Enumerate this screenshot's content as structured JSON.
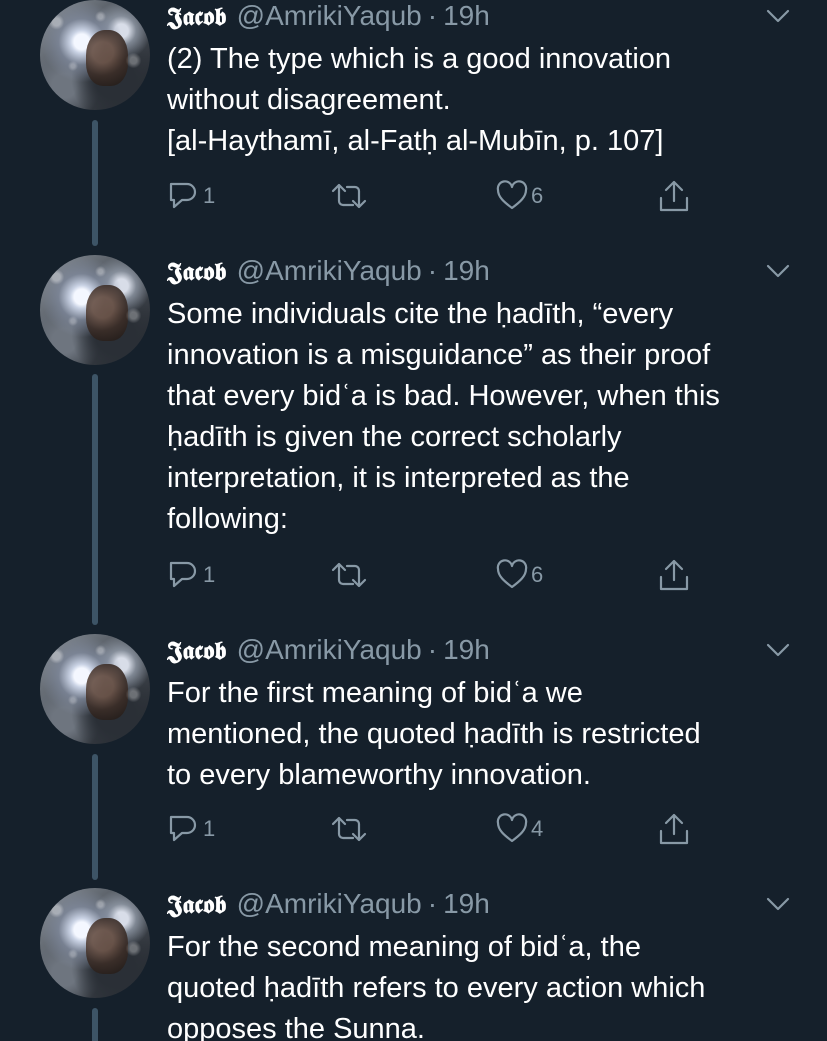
{
  "colors": {
    "background": "#15202b",
    "secondary_text": "#8899a6",
    "thread_line": "#3d5466",
    "primary_text": "#ffffff"
  },
  "tweets": [
    {
      "display_name": "𝕵𝖆𝖈𝖔𝖇",
      "handle": "@AmrikiYaqub",
      "separator": "·",
      "time": "19h",
      "text": "(2) The type which is a good innovation\nwithout disagreement.\n[al-Haythamī, al-Fatḥ al-Mubīn, p. 107]",
      "reply_count": "1",
      "retweet_count": "",
      "like_count": "6"
    },
    {
      "display_name": "𝕵𝖆𝖈𝖔𝖇",
      "handle": "@AmrikiYaqub",
      "separator": "·",
      "time": "19h",
      "text": "Some individuals cite the ḥadīth, “every\ninnovation is a misguidance” as their proof\nthat every bidʿa is bad. However, when this\nḥadīth is given the correct scholarly\ninterpretation, it is interpreted as the\nfollowing:",
      "reply_count": "1",
      "retweet_count": "",
      "like_count": "6"
    },
    {
      "display_name": "𝕵𝖆𝖈𝖔𝖇",
      "handle": "@AmrikiYaqub",
      "separator": "·",
      "time": "19h",
      "text": "For the first meaning of bidʿa we\nmentioned, the quoted ḥadīth is restricted\nto every blameworthy innovation.",
      "reply_count": "1",
      "retweet_count": "",
      "like_count": "4"
    },
    {
      "display_name": "𝕵𝖆𝖈𝖔𝖇",
      "handle": "@AmrikiYaqub",
      "separator": "·",
      "time": "19h",
      "text": "For the second meaning of bidʿa, the\nquoted ḥadīth refers to every action which\nopposes the Sunna."
    }
  ],
  "icons": {
    "reply": "reply-icon",
    "retweet": "retweet-icon",
    "like": "heart-icon",
    "share": "share-icon",
    "menu": "chevron-down-icon"
  }
}
